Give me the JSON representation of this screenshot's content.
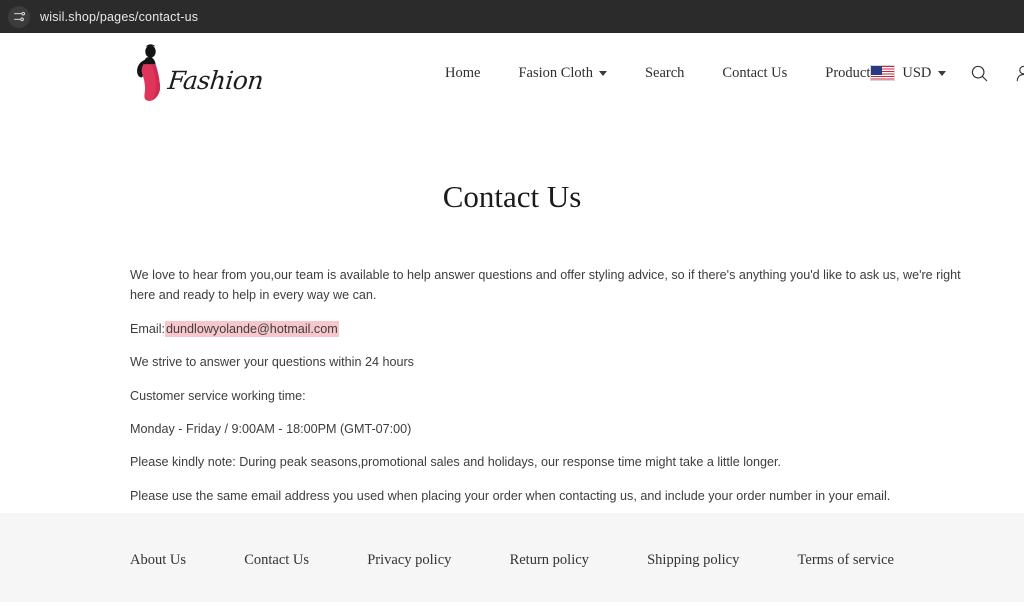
{
  "browser": {
    "url": "wisil.shop/pages/contact-us",
    "left_icon": "tune-sliders-icon"
  },
  "header": {
    "logo": {
      "script_text": "Fashion",
      "mark_icon": "woman-silhouette-icon",
      "dress_color": "#e0355a",
      "figure_color": "#141414"
    },
    "nav": [
      {
        "label": "Home",
        "has_caret": false
      },
      {
        "label": "Fasion Cloth",
        "has_caret": true
      },
      {
        "label": "Search",
        "has_caret": false
      },
      {
        "label": "Contact Us",
        "has_caret": false
      },
      {
        "label": "Product",
        "has_caret": false
      }
    ],
    "currency": {
      "label": "USD",
      "flag_icon": "us-flag-icon"
    },
    "icons": [
      {
        "name": "search-icon"
      },
      {
        "name": "account-icon"
      },
      {
        "name": "cart-icon"
      }
    ]
  },
  "main": {
    "title": "Contact Us",
    "intro": "We love to hear from you,our team is available to help answer questions and offer styling advice, so if there's anything you'd like to ask us, we're right here and ready to help in every way we can.",
    "email_label": "Email:",
    "email_address": "dundlowyolande@hotmail.com",
    "email_highlight_color": "#f7c7cd",
    "paragraphs": [
      "We strive to answer your questions within 24 hours",
      "Customer service working time:",
      "Monday - Friday / 9:00AM - 18:00PM (GMT-07:00)",
      "Please kindly note: During peak seasons,promotional sales and holidays, our response time might take a little longer.",
      "Please use the same email address you used when placing your order when contacting us, and include your order number in your email."
    ]
  },
  "footer": {
    "links": [
      "About Us",
      "Contact Us",
      "Privacy policy",
      "Return policy",
      "Shipping policy",
      "Terms of service"
    ]
  }
}
